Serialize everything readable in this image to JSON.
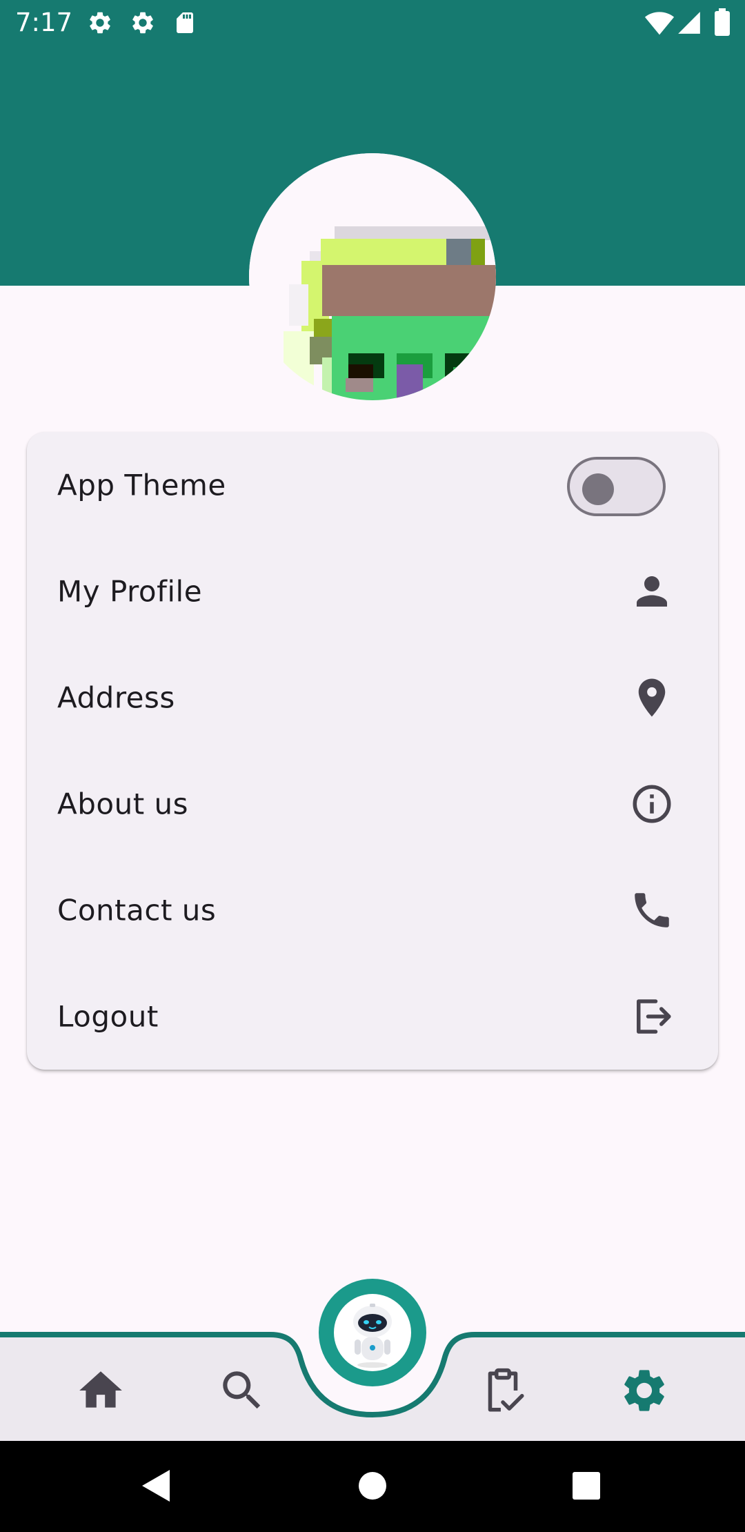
{
  "status_bar": {
    "time": "7:17",
    "left_icons": [
      "gear-icon",
      "gear-icon",
      "sd-card-icon"
    ],
    "right_icons": [
      "wifi-icon",
      "signal-icon",
      "battery-icon"
    ]
  },
  "colors": {
    "header": "#167A70",
    "accent": "#167A70",
    "background": "#FDF7FC",
    "card": "#F3EFF5",
    "nav_bar": "#ECE8EE",
    "fab": "#1B9A8B",
    "icon_inactive": "#49454F"
  },
  "profile": {
    "avatar_icon": "pixel-art-avatar"
  },
  "settings": {
    "items": [
      {
        "label": "App Theme",
        "control": "toggle",
        "toggle_on": false
      },
      {
        "label": "My Profile",
        "icon": "person-icon"
      },
      {
        "label": "Address",
        "icon": "location-pin-icon"
      },
      {
        "label": "About us",
        "icon": "info-icon"
      },
      {
        "label": "Contact us",
        "icon": "phone-icon"
      },
      {
        "label": "Logout",
        "icon": "logout-icon"
      }
    ]
  },
  "bottom_nav": {
    "items": [
      {
        "icon": "home-icon",
        "active": false
      },
      {
        "icon": "search-icon",
        "active": false
      },
      {
        "icon": "robot-assistant-icon",
        "active": false,
        "center_fab": true
      },
      {
        "icon": "clipboard-check-icon",
        "active": false
      },
      {
        "icon": "gear-icon",
        "active": true
      }
    ]
  },
  "system_nav": {
    "buttons": [
      "back-icon",
      "home-circle-icon",
      "recents-square-icon"
    ]
  }
}
